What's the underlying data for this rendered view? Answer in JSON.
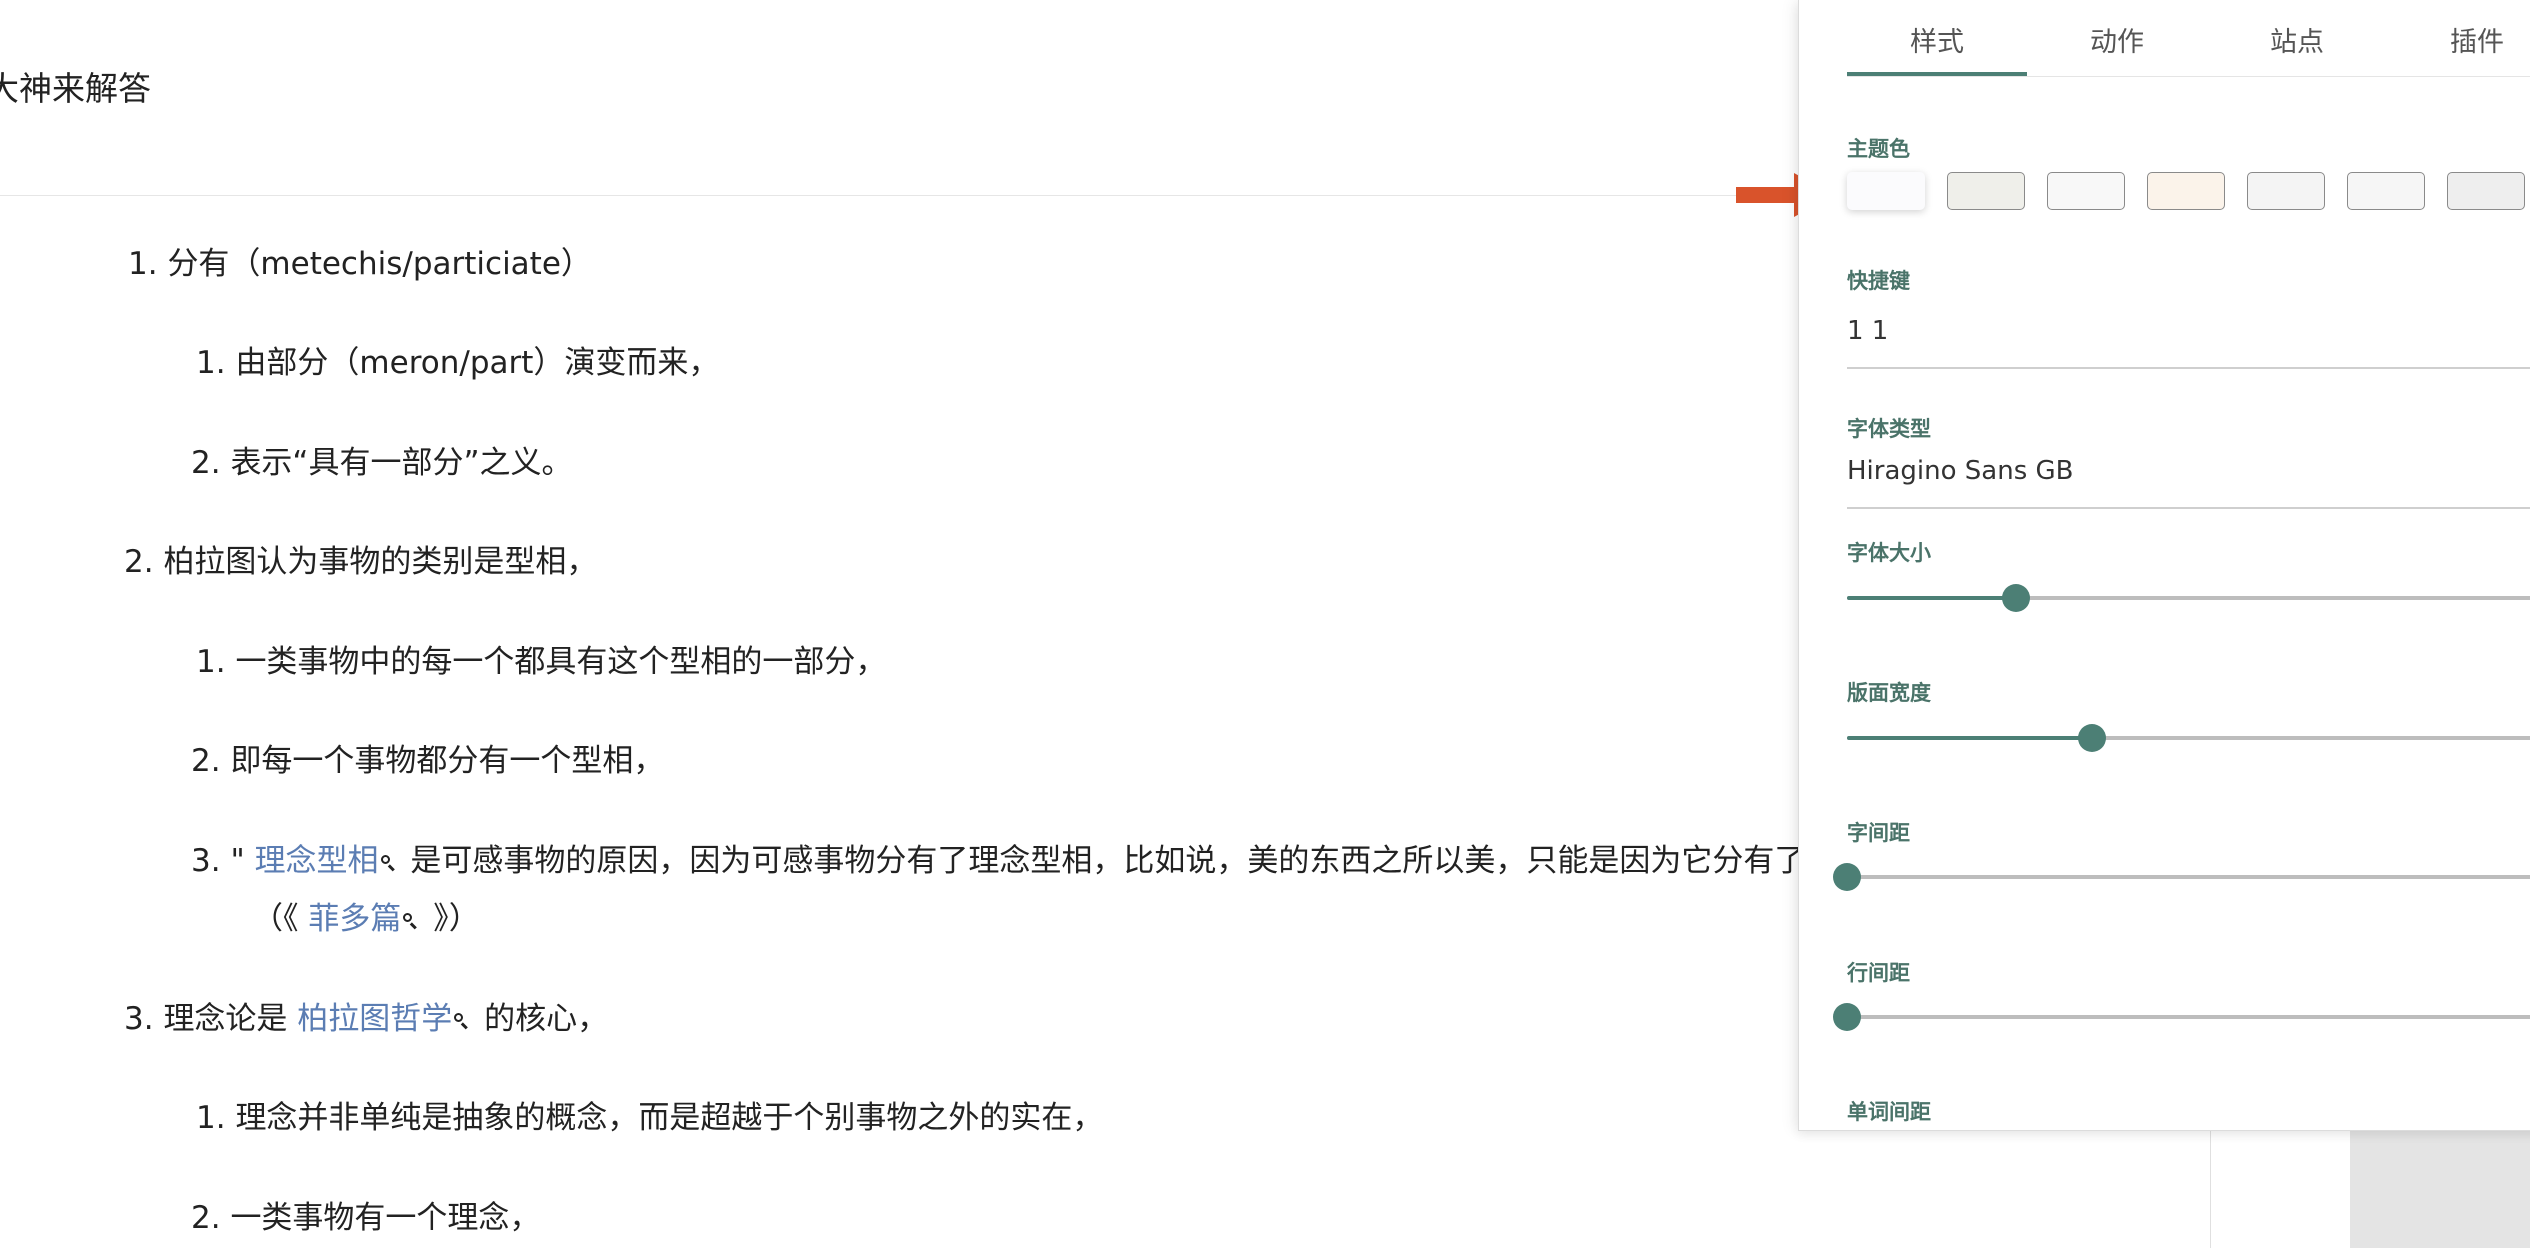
{
  "article": {
    "title": "大神来解答",
    "items": [
      {
        "num": "1.",
        "text": "分有（metechis/particiate）"
      },
      {
        "num": "1.",
        "text": "由部分（meron/part）演变而来，"
      },
      {
        "num": "2.",
        "text": "表示“具有一部分”之义。"
      },
      {
        "num": "2.",
        "text": "柏拉图认为事物的类别是型相，"
      },
      {
        "num": "1.",
        "text": "一类事物中的每一个都具有这个型相的一部分，"
      },
      {
        "num": "2.",
        "text": "即每一个事物都分有一个型相，"
      },
      {
        "num": "3.",
        "pre": "\" ",
        "link": "理念型相",
        "text": " 是可感事物的原因，因为可感事物分有了理念型相，比如说，美的东西之所以美，只能是因为它分有了“美”",
        "line2_pre": "（《 ",
        "line2_link": "菲多篇",
        "line2_post": " 》）"
      },
      {
        "num": "3.",
        "pre": "理念论是 ",
        "link": "柏拉图哲学",
        "text": " 的核心，"
      },
      {
        "num": "1.",
        "text": "理念并非单纯是抽象的概念，而是超越于个别事物之外的实在，"
      },
      {
        "num": "2.",
        "text": "一类事物有一个理念，"
      }
    ]
  },
  "panel": {
    "tabs": [
      "样式",
      "动作",
      "站点",
      "插件"
    ],
    "active_tab": "样式",
    "theme_label": "主题色",
    "theme_colors": [
      "#fbfbfd",
      "#efefea",
      "#f8f8f8",
      "#fbf3ea",
      "#f4f4f4",
      "#f6f6f6",
      "#eeeeee"
    ],
    "selected_theme": 0,
    "shortcut_label": "快捷键",
    "shortcut_value": "1 1",
    "font_label": "字体类型",
    "font_value": "Hiragino Sans GB",
    "font_size_label": "字体大小",
    "font_size_level": 0.235,
    "width_label": "版面宽度",
    "width_level": 0.34,
    "letter_spacing_label": "字间距",
    "letter_spacing_level": 0,
    "line_spacing_label": "行间距",
    "line_spacing_level": 0,
    "word_spacing_label": "单词间距",
    "accent_color": "#4c7f75",
    "arrow_color": "#d9532b"
  }
}
